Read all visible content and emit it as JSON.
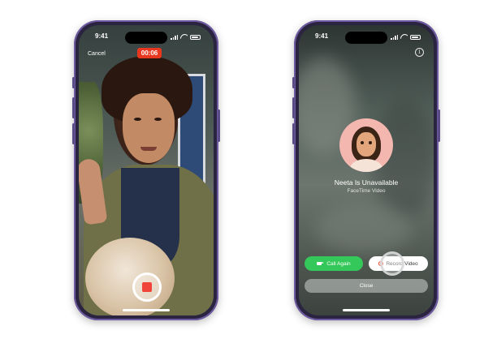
{
  "left_phone": {
    "status_time": "9:41",
    "cancel_label": "Cancel",
    "recording_timer": "00:06"
  },
  "right_phone": {
    "status_time": "9:41",
    "info_icon": "i",
    "contact_name": "Neeta Is Unavailable",
    "call_type": "FaceTime Video",
    "call_again_label": "Call Again",
    "record_video_label": "Record Video",
    "close_label": "Close"
  },
  "colors": {
    "phone_frame": "#2b2440",
    "record_red": "#e8361f",
    "call_green": "#34c759",
    "avatar_pink": "#f3b7b0"
  },
  "icons": [
    "signal-icon",
    "wifi-icon",
    "battery-icon",
    "info-icon",
    "video-camera-icon",
    "record-icon",
    "stop-icon"
  ]
}
